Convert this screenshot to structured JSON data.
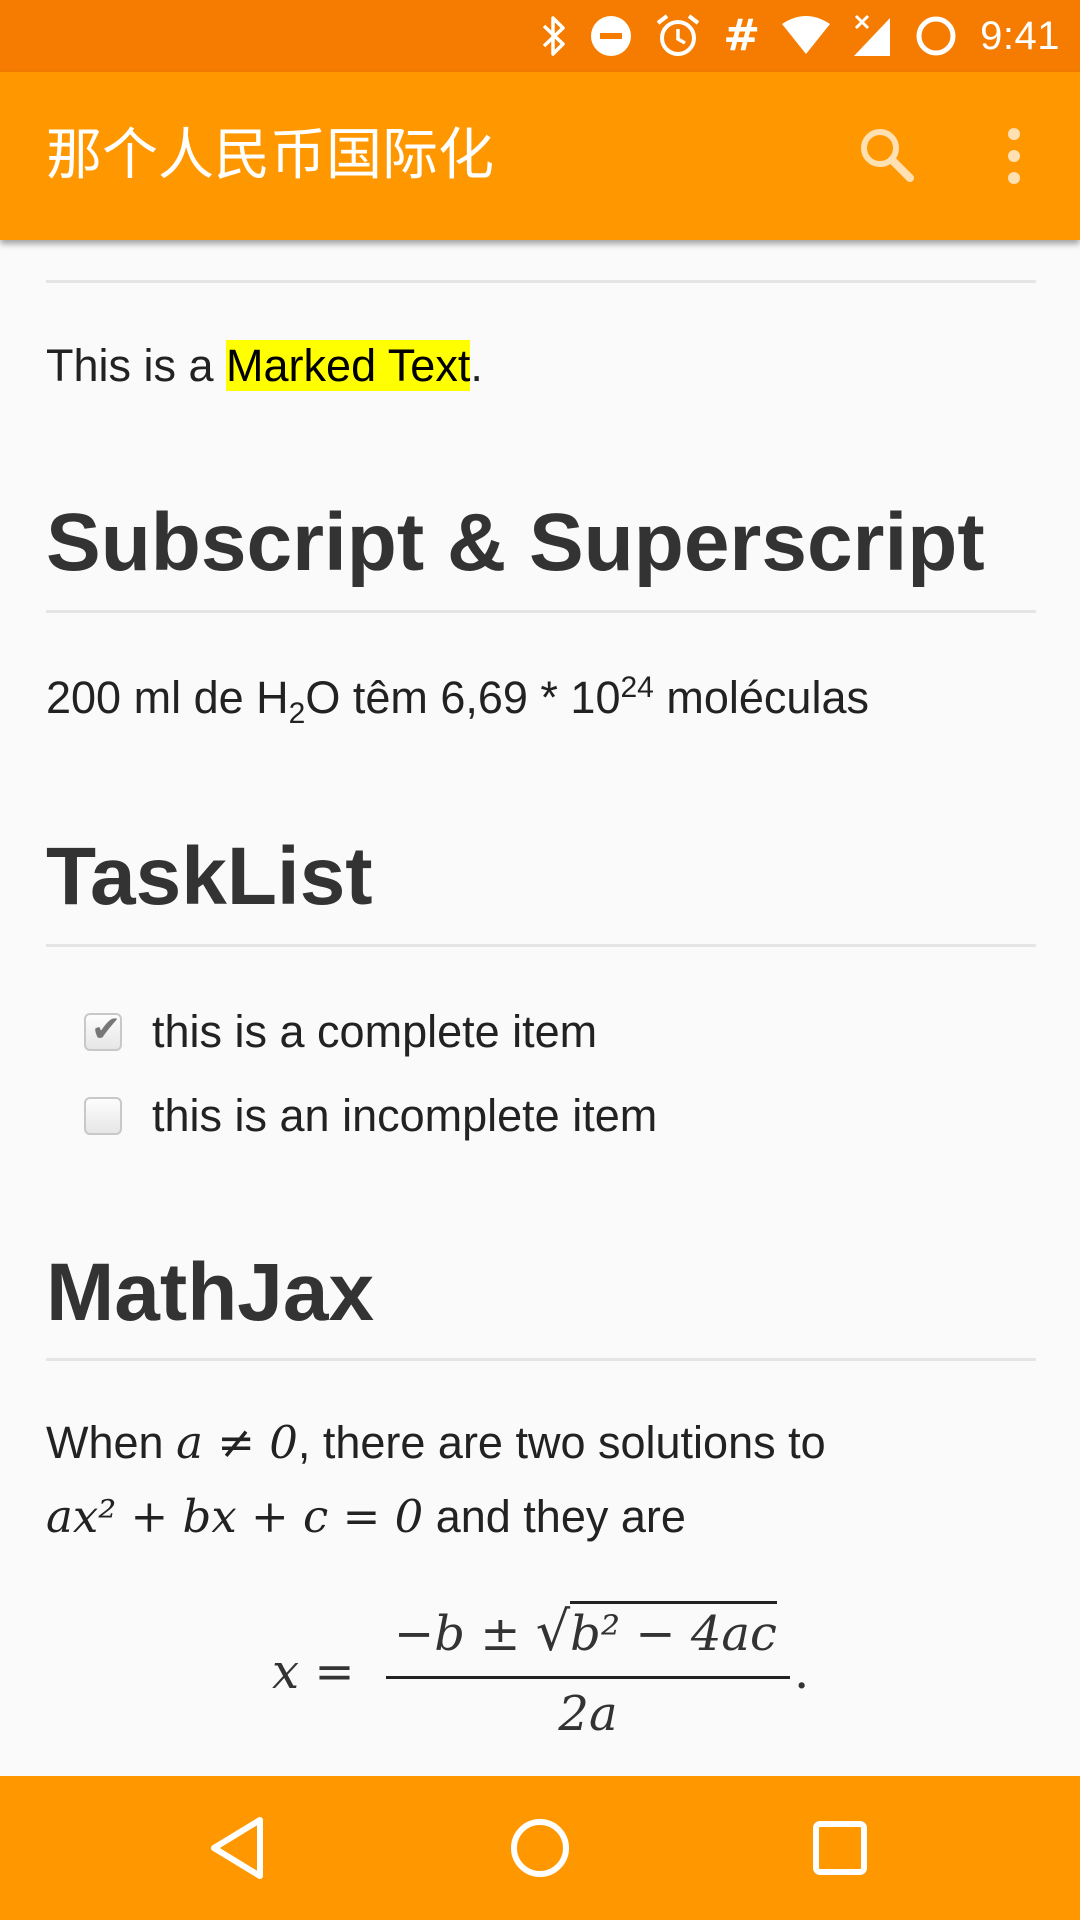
{
  "status_bar": {
    "time": "9:41",
    "hash": "#",
    "icons": [
      "bluetooth-icon",
      "do-not-disturb-icon",
      "alarm-icon",
      "hash-icon",
      "wifi-icon",
      "signal-no-data-icon",
      "battery-icon"
    ]
  },
  "app_bar": {
    "title": "那个人民币国际化",
    "actions": [
      "search-icon",
      "more-vert-icon"
    ]
  },
  "content": {
    "marked_para": {
      "before": "This is a ",
      "marked": "Marked Text",
      "after": "."
    },
    "subsup": {
      "heading": "Subscript & Superscript",
      "p1": "200 ml de H",
      "sub": "2",
      "p2": "O têm 6,69 * 10",
      "sup": "24",
      "p3": " moléculas"
    },
    "tasklist": {
      "heading": "TaskList",
      "items": [
        {
          "label": "this is a complete item",
          "checked": true
        },
        {
          "label": "this is an incomplete item",
          "checked": false
        }
      ]
    },
    "mathjax": {
      "heading": "MathJax",
      "line1_text_a": "When ",
      "line1_math": "a ≠ 0",
      "line1_text_b": ", there are two solutions to",
      "line2_math": "ax² + bx + c = 0",
      "line2_text": " and they are",
      "formula_lhs": "x =",
      "formula_num_a": "−b ± ",
      "formula_num_radicand": "b² − 4ac",
      "formula_den": "2a",
      "formula_end": "."
    }
  },
  "nav_bar": {
    "buttons": [
      "back-icon",
      "home-icon",
      "recents-icon"
    ]
  },
  "colors": {
    "status_bar": "#f57c00",
    "app_bar": "#ff9800",
    "highlight": "#ffff00"
  }
}
